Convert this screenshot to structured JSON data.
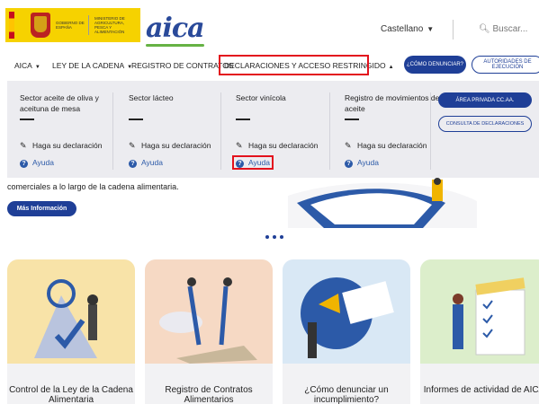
{
  "header": {
    "gov_line1": "Gobierno de España",
    "gov_line2": "Ministerio de Agricultura, Pesca y Alimentación",
    "logo": "aica",
    "language": "Castellano",
    "search_placeholder": "Buscar..."
  },
  "nav": {
    "items": [
      "AICA",
      "LEY DE LA CADENA",
      "REGISTRO DE CONTRATOS",
      "DECLARACIONES Y ACCESO RESTRINGIDO"
    ],
    "how_to_report": "¿CÓMO DENUNCIAR?",
    "authorities": "AUTORIDADES DE EJECUCIÓN"
  },
  "mega_menu": {
    "columns": [
      {
        "title": "Sector aceite de oliva y aceituna de mesa",
        "declare": "Haga su declaración",
        "help": "Ayuda"
      },
      {
        "title": "Sector lácteo",
        "declare": "Haga su declaración",
        "help": "Ayuda"
      },
      {
        "title": "Sector vinícola",
        "declare": "Haga su declaración",
        "help": "Ayuda"
      },
      {
        "title": "Registro de movimientos de aceite",
        "declare": "Haga su declaración",
        "help": "Ayuda"
      }
    ],
    "private_area": "ÁREA PRIVADA CC.AA.",
    "query_declarations": "CONSULTA DE DECLARACIONES"
  },
  "hero": {
    "text": "comerciales a lo largo de la cadena alimentaria.",
    "more": "Más Información"
  },
  "cards": [
    {
      "caption": "Control de la Ley de la Cadena Alimentaria"
    },
    {
      "caption": "Registro de Contratos Alimentarios"
    },
    {
      "caption": "¿Cómo denunciar un incumplimiento?"
    },
    {
      "caption": "Informes de actividad de AICA"
    }
  ],
  "colors": {
    "primary": "#1f3f97",
    "highlight": "#e3121d",
    "logo_green": "#66b244"
  }
}
